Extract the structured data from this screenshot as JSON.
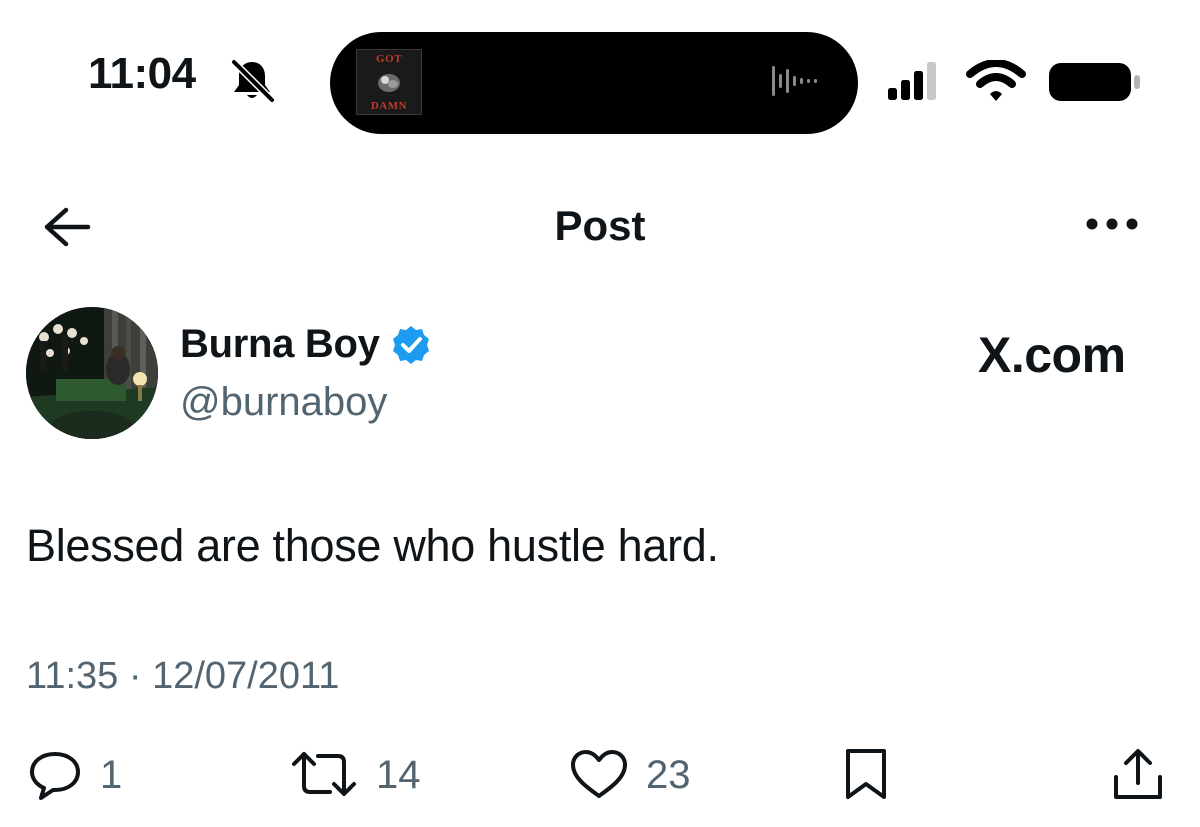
{
  "status_bar": {
    "time": "11:04",
    "silent_icon": "bell-slash-icon",
    "now_playing_art": {
      "top_text": "GOT",
      "bottom_text": "DAMN"
    },
    "waveform_icon": "audio-waveform-icon",
    "signal_icon": "cellular-signal-icon",
    "wifi_icon": "wifi-icon",
    "battery_icon": "battery-icon"
  },
  "nav": {
    "back_icon": "back-arrow-icon",
    "title": "Post",
    "more_icon": "more-dots-icon"
  },
  "post": {
    "author_name": "Burna Boy",
    "verified_icon": "verified-badge-icon",
    "verified_color": "#1d9bf0",
    "handle": "@burnaboy",
    "brand": "X.com",
    "text": "Blessed are those who hustle hard.",
    "time": "11:35",
    "separator": "·",
    "date": "12/07/2011"
  },
  "actions": {
    "reply": {
      "icon": "reply-icon",
      "count": "1"
    },
    "repost": {
      "icon": "repost-icon",
      "count": "14"
    },
    "like": {
      "icon": "heart-icon",
      "count": "23"
    },
    "bookmark": {
      "icon": "bookmark-icon"
    },
    "share": {
      "icon": "share-icon"
    }
  },
  "colors": {
    "text_primary": "#0f1419",
    "text_secondary": "#536471",
    "background": "#ffffff"
  }
}
